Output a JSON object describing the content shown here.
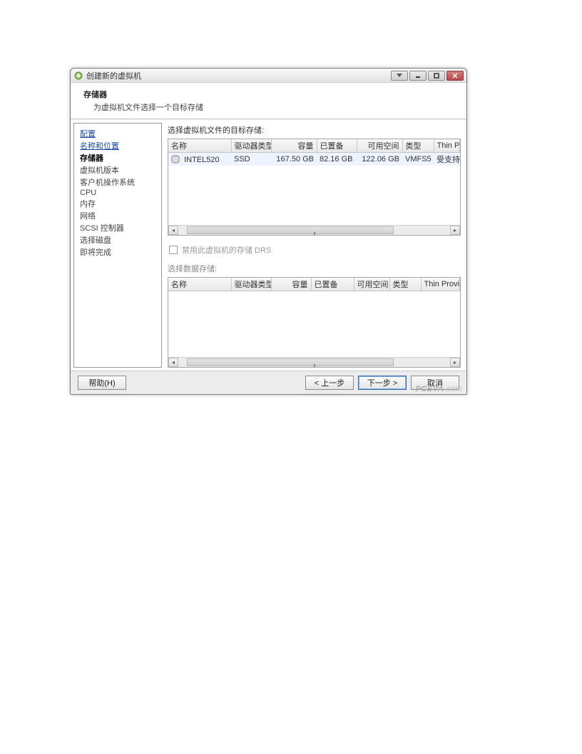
{
  "window": {
    "title": "创建新的虚拟机"
  },
  "header": {
    "title": "存储器",
    "subtitle": "为虚拟机文件选择一个目标存储"
  },
  "sidebar": {
    "items": [
      {
        "label": "配置",
        "type": "link"
      },
      {
        "label": "名称和位置",
        "type": "link"
      },
      {
        "label": "存储器",
        "type": "current"
      },
      {
        "label": "虚拟机版本",
        "type": "step"
      },
      {
        "label": "客户机操作系统",
        "type": "step"
      },
      {
        "label": "CPU",
        "type": "step"
      },
      {
        "label": "内存",
        "type": "step"
      },
      {
        "label": "网络",
        "type": "step"
      },
      {
        "label": "SCSI 控制器",
        "type": "step"
      },
      {
        "label": "选择磁盘",
        "type": "step"
      },
      {
        "label": "即将完成",
        "type": "step"
      }
    ]
  },
  "main": {
    "select_label": "选择虚拟机文件的目标存储:",
    "columns": {
      "name": "名称",
      "drive_type": "驱动器类型",
      "capacity": "容量",
      "provisioned": "已置备",
      "free": "可用空间",
      "type": "类型",
      "thin": "Thin Prov"
    },
    "rows": [
      {
        "name": "INTEL520",
        "drive_type": "SSD",
        "capacity": "167.50 GB",
        "provisioned": "82.16 GB",
        "free": "122.06 GB",
        "type": "VMFS5",
        "thin": "受支持"
      }
    ],
    "drs_checkbox": "禁用此虚拟机的存储 DRS",
    "datastore_label": "选择数据存储:",
    "columns2": {
      "name": "名称",
      "drive_type": "驱动器类型",
      "capacity": "容量",
      "provisioned": "已置备",
      "free": "可用空间",
      "type": "类型",
      "thin": "Thin Provi"
    }
  },
  "footer": {
    "help": "帮助(H)",
    "back": "< 上一步",
    "next": "下一步 >",
    "cancel": "取消"
  },
  "watermark": {
    "brand": "PCEVA",
    "suffix": ".com"
  }
}
